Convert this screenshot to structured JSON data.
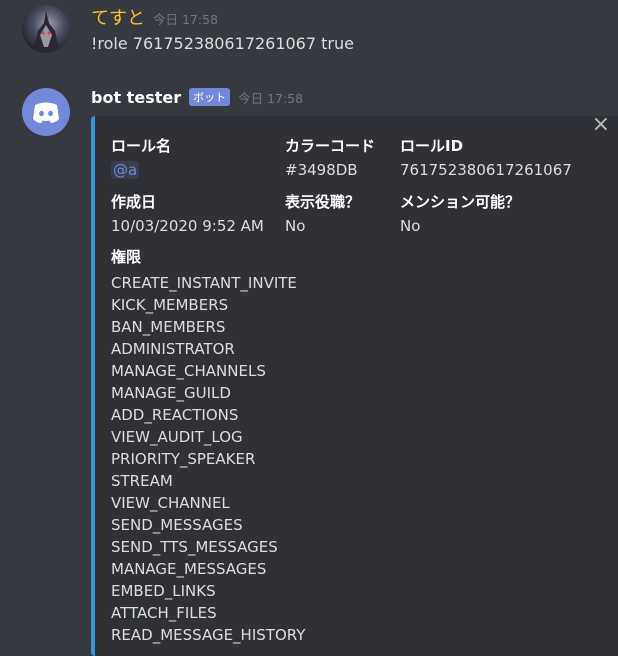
{
  "messages": [
    {
      "username": "てすと",
      "timestamp": "今日 17:58",
      "content": "!role 761752380617261067 true",
      "username_color": "#f9c22b"
    },
    {
      "username": "bot tester",
      "bot_tag": "ボット",
      "timestamp": "今日 17:58",
      "embed": {
        "accent_color": "#3498db",
        "close_symbol": "×",
        "fields": [
          {
            "name": "ロール名",
            "value": "@a"
          },
          {
            "name": "カラーコード",
            "value": "#3498DB"
          },
          {
            "name": "ロールID",
            "value": "761752380617261067"
          },
          {
            "name": "作成日",
            "value": "10/03/2020 9:52 AM"
          },
          {
            "name": "表示役職？",
            "value": "No"
          },
          {
            "name": "メンション可能？",
            "value": "No"
          }
        ],
        "permissions_title": "権限",
        "permissions": [
          "CREATE_INSTANT_INVITE",
          "KICK_MEMBERS",
          "BAN_MEMBERS",
          "ADMINISTRATOR",
          "MANAGE_CHANNELS",
          "MANAGE_GUILD",
          "ADD_REACTIONS",
          "VIEW_AUDIT_LOG",
          "PRIORITY_SPEAKER",
          "STREAM",
          "VIEW_CHANNEL",
          "SEND_MESSAGES",
          "SEND_TTS_MESSAGES",
          "MANAGE_MESSAGES",
          "EMBED_LINKS",
          "ATTACH_FILES",
          "READ_MESSAGE_HISTORY"
        ]
      }
    }
  ],
  "colors": {
    "background": "#36393f",
    "embed_background": "#2f3136",
    "bot_tag": "#7289da",
    "mention": "#7289da"
  }
}
